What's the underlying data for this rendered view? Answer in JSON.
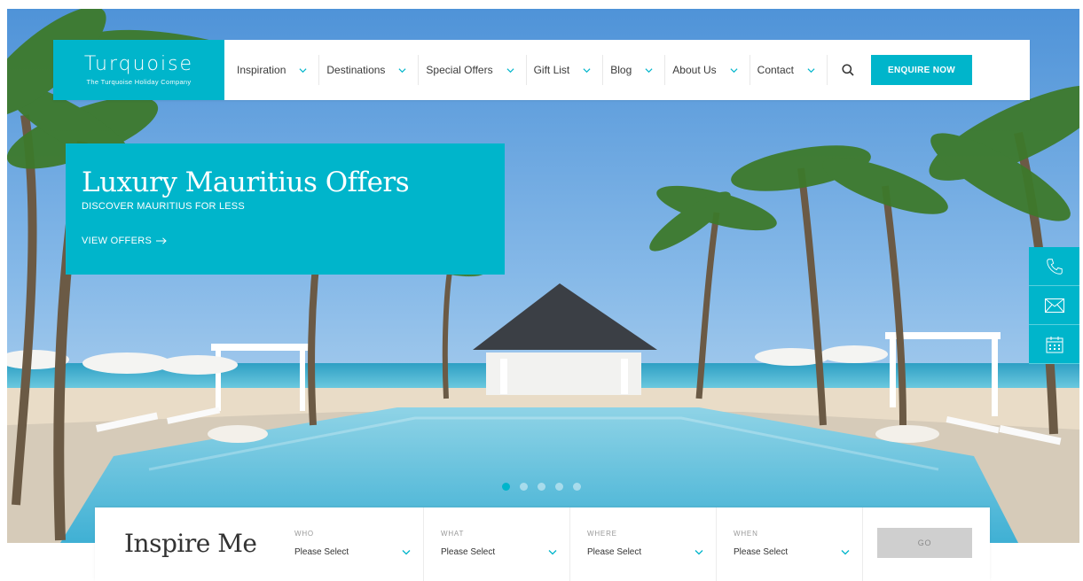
{
  "brand": {
    "name": "Turquoise",
    "tagline": "The Turquoise Holiday Company",
    "accent_color": "#00b5cb"
  },
  "nav": {
    "items": [
      {
        "label": "Inspiration",
        "icon": "chevron-down-icon"
      },
      {
        "label": "Destinations",
        "icon": "chevron-down-icon"
      },
      {
        "label": "Special Offers",
        "icon": "chevron-down-icon"
      },
      {
        "label": "Gift List",
        "icon": "chevron-down-icon"
      },
      {
        "label": "Blog",
        "icon": "chevron-down-icon"
      },
      {
        "label": "About Us",
        "icon": "chevron-down-icon"
      },
      {
        "label": "Contact",
        "icon": "chevron-down-icon"
      }
    ],
    "search_icon": "search-icon",
    "cta_label": "ENQUIRE NOW"
  },
  "promo": {
    "title": "Luxury Mauritius Offers",
    "subtitle": "DISCOVER MAURITIUS FOR LESS",
    "link_label": "VIEW OFFERS",
    "link_icon": "arrow-right-icon"
  },
  "side_contact": [
    {
      "icon": "phone-icon"
    },
    {
      "icon": "envelope-icon"
    },
    {
      "icon": "calendar-icon"
    }
  ],
  "slider": {
    "slide_count": 5,
    "active_index": 0
  },
  "inspire": {
    "title": "Inspire Me",
    "fields": [
      {
        "label": "WHO",
        "value": "Please Select"
      },
      {
        "label": "WHAT",
        "value": "Please Select"
      },
      {
        "label": "WHERE",
        "value": "Please Select"
      },
      {
        "label": "WHEN",
        "value": "Please Select"
      }
    ],
    "go_label": "GO"
  }
}
